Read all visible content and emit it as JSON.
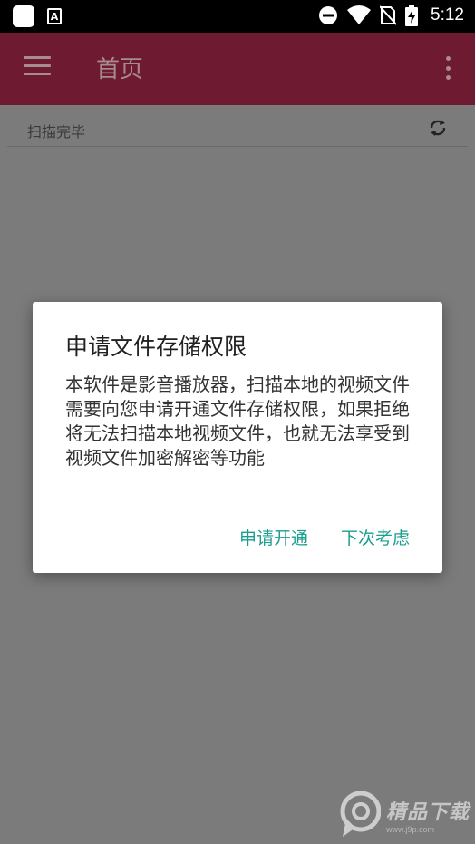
{
  "status_bar": {
    "time": "5:12",
    "icons": [
      "app-notification-icon",
      "font-icon",
      "do-not-disturb-icon",
      "wifi-icon",
      "no-sim-icon",
      "battery-charging-icon"
    ]
  },
  "app_bar": {
    "title": "首页",
    "background_color": "#6e1a30",
    "icons": [
      "menu-icon",
      "more-vert-icon"
    ]
  },
  "scan_bar": {
    "status_text": "扫描完毕",
    "icon": "refresh-icon"
  },
  "dialog": {
    "title": "申请文件存储权限",
    "message": "本软件是影音播放器，扫描本地的视频文件需要向您申请开通文件存储权限，如果拒绝将无法扫描本地视频文件，也就无法享受到视频文件加密解密等功能",
    "positive_button": "申请开通",
    "negative_button": "下次考虑",
    "accent_color": "#1a9e8e"
  },
  "watermark": {
    "text": "精品下载",
    "url": "www.j9p.com"
  }
}
